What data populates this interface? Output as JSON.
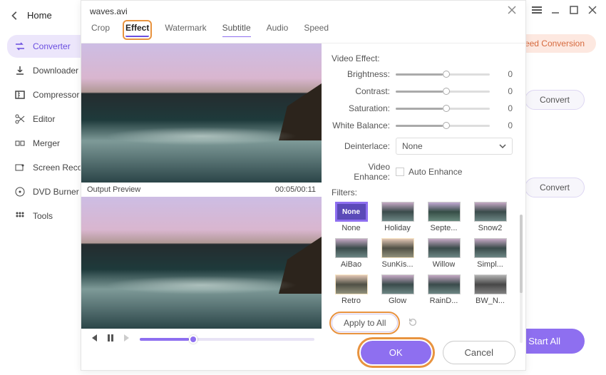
{
  "window": {
    "title": "waves.avi"
  },
  "sidebar": {
    "home": "Home",
    "items": [
      {
        "label": "Converter",
        "icon": "converter",
        "active": true
      },
      {
        "label": "Downloader",
        "icon": "download"
      },
      {
        "label": "Compressor",
        "icon": "compress"
      },
      {
        "label": "Editor",
        "icon": "scissors"
      },
      {
        "label": "Merger",
        "icon": "merge"
      },
      {
        "label": "Screen Recorder",
        "icon": "record"
      },
      {
        "label": "DVD Burner",
        "icon": "disc"
      },
      {
        "label": "Tools",
        "icon": "grid"
      }
    ]
  },
  "background": {
    "speed_badge": "speed Conversion",
    "convert_label": "Convert",
    "start_all": "Start All"
  },
  "dialog": {
    "tabs": [
      "Crop",
      "Effect",
      "Watermark",
      "Subtitle",
      "Audio",
      "Speed"
    ],
    "active_tab": "Effect",
    "preview_label": "Output Preview",
    "time": "00:05/00:11",
    "video_effect": {
      "title": "Video Effect:",
      "brightness_label": "Brightness:",
      "contrast_label": "Contrast:",
      "saturation_label": "Saturation:",
      "whitebalance_label": "White Balance:",
      "brightness": 0,
      "contrast": 0,
      "saturation": 0,
      "white_balance": 0,
      "deinterlace_label": "Deinterlace:",
      "deinterlace_value": "None",
      "enhance_label": "Video Enhance:",
      "auto_enhance": "Auto Enhance"
    },
    "filters_title": "Filters:",
    "filters": [
      {
        "name": "None",
        "sel": true
      },
      {
        "name": "Holiday"
      },
      {
        "name": "Septe..."
      },
      {
        "name": "Snow2"
      },
      {
        "name": "AiBao"
      },
      {
        "name": "SunKis..."
      },
      {
        "name": "Willow"
      },
      {
        "name": "Simpl..."
      },
      {
        "name": "Retro"
      },
      {
        "name": "Glow"
      },
      {
        "name": "RainD..."
      },
      {
        "name": "BW_N..."
      }
    ],
    "apply_all": "Apply to All",
    "ok": "OK",
    "cancel": "Cancel"
  }
}
